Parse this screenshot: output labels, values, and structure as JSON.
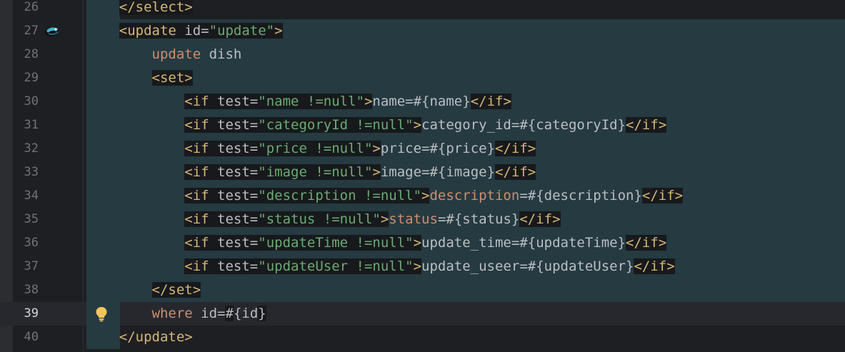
{
  "editor": {
    "lines": [
      {
        "number": "26",
        "segments": [
          {
            "text": "    ",
            "cls": ""
          },
          {
            "text": "</select>",
            "cls": "tb"
          }
        ]
      },
      {
        "number": "27",
        "icon": "mybatis-mapper-icon",
        "segments": [
          {
            "text": "    ",
            "cls": ""
          },
          {
            "text": "<update ",
            "cls": "tb"
          },
          {
            "text": "id=",
            "cls": "p hl"
          },
          {
            "text": "\"update\"",
            "cls": "s hl"
          },
          {
            "text": ">",
            "cls": "tb"
          }
        ]
      },
      {
        "number": "28",
        "segments": [
          {
            "text": "        ",
            "cls": ""
          },
          {
            "text": "update",
            "cls": "k"
          },
          {
            "text": " dish",
            "cls": "p"
          }
        ]
      },
      {
        "number": "29",
        "segments": [
          {
            "text": "        ",
            "cls": ""
          },
          {
            "text": "<set>",
            "cls": "tb"
          }
        ]
      },
      {
        "number": "30",
        "segments": [
          {
            "text": "            ",
            "cls": ""
          },
          {
            "text": "<if ",
            "cls": "tb"
          },
          {
            "text": "test=",
            "cls": "p hl"
          },
          {
            "text": "\"name !=null\"",
            "cls": "s hl"
          },
          {
            "text": ">",
            "cls": "tb"
          },
          {
            "text": "name=#{name}",
            "cls": "p"
          },
          {
            "text": "</if>",
            "cls": "tb"
          }
        ]
      },
      {
        "number": "31",
        "segments": [
          {
            "text": "            ",
            "cls": ""
          },
          {
            "text": "<if ",
            "cls": "tb"
          },
          {
            "text": "test=",
            "cls": "p hl"
          },
          {
            "text": "\"categoryId !=null\"",
            "cls": "s hl"
          },
          {
            "text": ">",
            "cls": "tb"
          },
          {
            "text": "category_id=#{categoryId}",
            "cls": "p"
          },
          {
            "text": "</if>",
            "cls": "tb"
          }
        ]
      },
      {
        "number": "32",
        "segments": [
          {
            "text": "            ",
            "cls": ""
          },
          {
            "text": "<if ",
            "cls": "tb"
          },
          {
            "text": "test=",
            "cls": "p hl"
          },
          {
            "text": "\"price !=null\"",
            "cls": "s hl"
          },
          {
            "text": ">",
            "cls": "tb"
          },
          {
            "text": "price=#{price}",
            "cls": "p"
          },
          {
            "text": "</if>",
            "cls": "tb"
          }
        ]
      },
      {
        "number": "33",
        "segments": [
          {
            "text": "            ",
            "cls": ""
          },
          {
            "text": "<if ",
            "cls": "tb"
          },
          {
            "text": "test=",
            "cls": "p hl"
          },
          {
            "text": "\"image !=null\"",
            "cls": "s hl"
          },
          {
            "text": ">",
            "cls": "tb"
          },
          {
            "text": "image=#{image}",
            "cls": "p"
          },
          {
            "text": "</if>",
            "cls": "tb"
          }
        ]
      },
      {
        "number": "34",
        "segments": [
          {
            "text": "            ",
            "cls": ""
          },
          {
            "text": "<if ",
            "cls": "tb"
          },
          {
            "text": "test=",
            "cls": "p hl"
          },
          {
            "text": "\"description !=null\"",
            "cls": "s hl"
          },
          {
            "text": ">",
            "cls": "tb"
          },
          {
            "text": "description",
            "cls": "k"
          },
          {
            "text": "=#{description}",
            "cls": "p"
          },
          {
            "text": "</if>",
            "cls": "tb"
          }
        ]
      },
      {
        "number": "35",
        "segments": [
          {
            "text": "            ",
            "cls": ""
          },
          {
            "text": "<if ",
            "cls": "tb"
          },
          {
            "text": "test=",
            "cls": "p hl"
          },
          {
            "text": "\"status !=null\"",
            "cls": "s hl"
          },
          {
            "text": ">",
            "cls": "tb"
          },
          {
            "text": "status",
            "cls": "k"
          },
          {
            "text": "=#{status}",
            "cls": "p"
          },
          {
            "text": "</if>",
            "cls": "tb"
          }
        ]
      },
      {
        "number": "36",
        "segments": [
          {
            "text": "            ",
            "cls": ""
          },
          {
            "text": "<if ",
            "cls": "tb"
          },
          {
            "text": "test=",
            "cls": "p hl"
          },
          {
            "text": "\"updateTime !=null\"",
            "cls": "s hl"
          },
          {
            "text": ">",
            "cls": "tb"
          },
          {
            "text": "update_time=#{updateTime}",
            "cls": "p"
          },
          {
            "text": "</if>",
            "cls": "tb"
          }
        ]
      },
      {
        "number": "37",
        "segments": [
          {
            "text": "            ",
            "cls": ""
          },
          {
            "text": "<if ",
            "cls": "tb"
          },
          {
            "text": "test=",
            "cls": "p hl"
          },
          {
            "text": "\"updateUser !=null\"",
            "cls": "s hl"
          },
          {
            "text": ">",
            "cls": "tb"
          },
          {
            "text": "update_useer=#{updateUser}",
            "cls": "p"
          },
          {
            "text": "</if>",
            "cls": "tb"
          }
        ]
      },
      {
        "number": "38",
        "segments": [
          {
            "text": "        ",
            "cls": ""
          },
          {
            "text": "</set>",
            "cls": "tb"
          }
        ]
      },
      {
        "number": "39",
        "current": true,
        "icon": "lightbulb-icon",
        "segments": [
          {
            "text": "        ",
            "cls": ""
          },
          {
            "text": "where",
            "cls": "k"
          },
          {
            "text": " id=",
            "cls": "p"
          },
          {
            "text": "#",
            "cls": "p hl"
          },
          {
            "text": "{",
            "cls": "p"
          },
          {
            "text": "id",
            "cls": "p"
          },
          {
            "text": "}",
            "cls": "p hl"
          }
        ]
      },
      {
        "number": "40",
        "segments": [
          {
            "text": "    ",
            "cls": ""
          },
          {
            "text": "</update>",
            "cls": "t"
          }
        ]
      }
    ]
  }
}
